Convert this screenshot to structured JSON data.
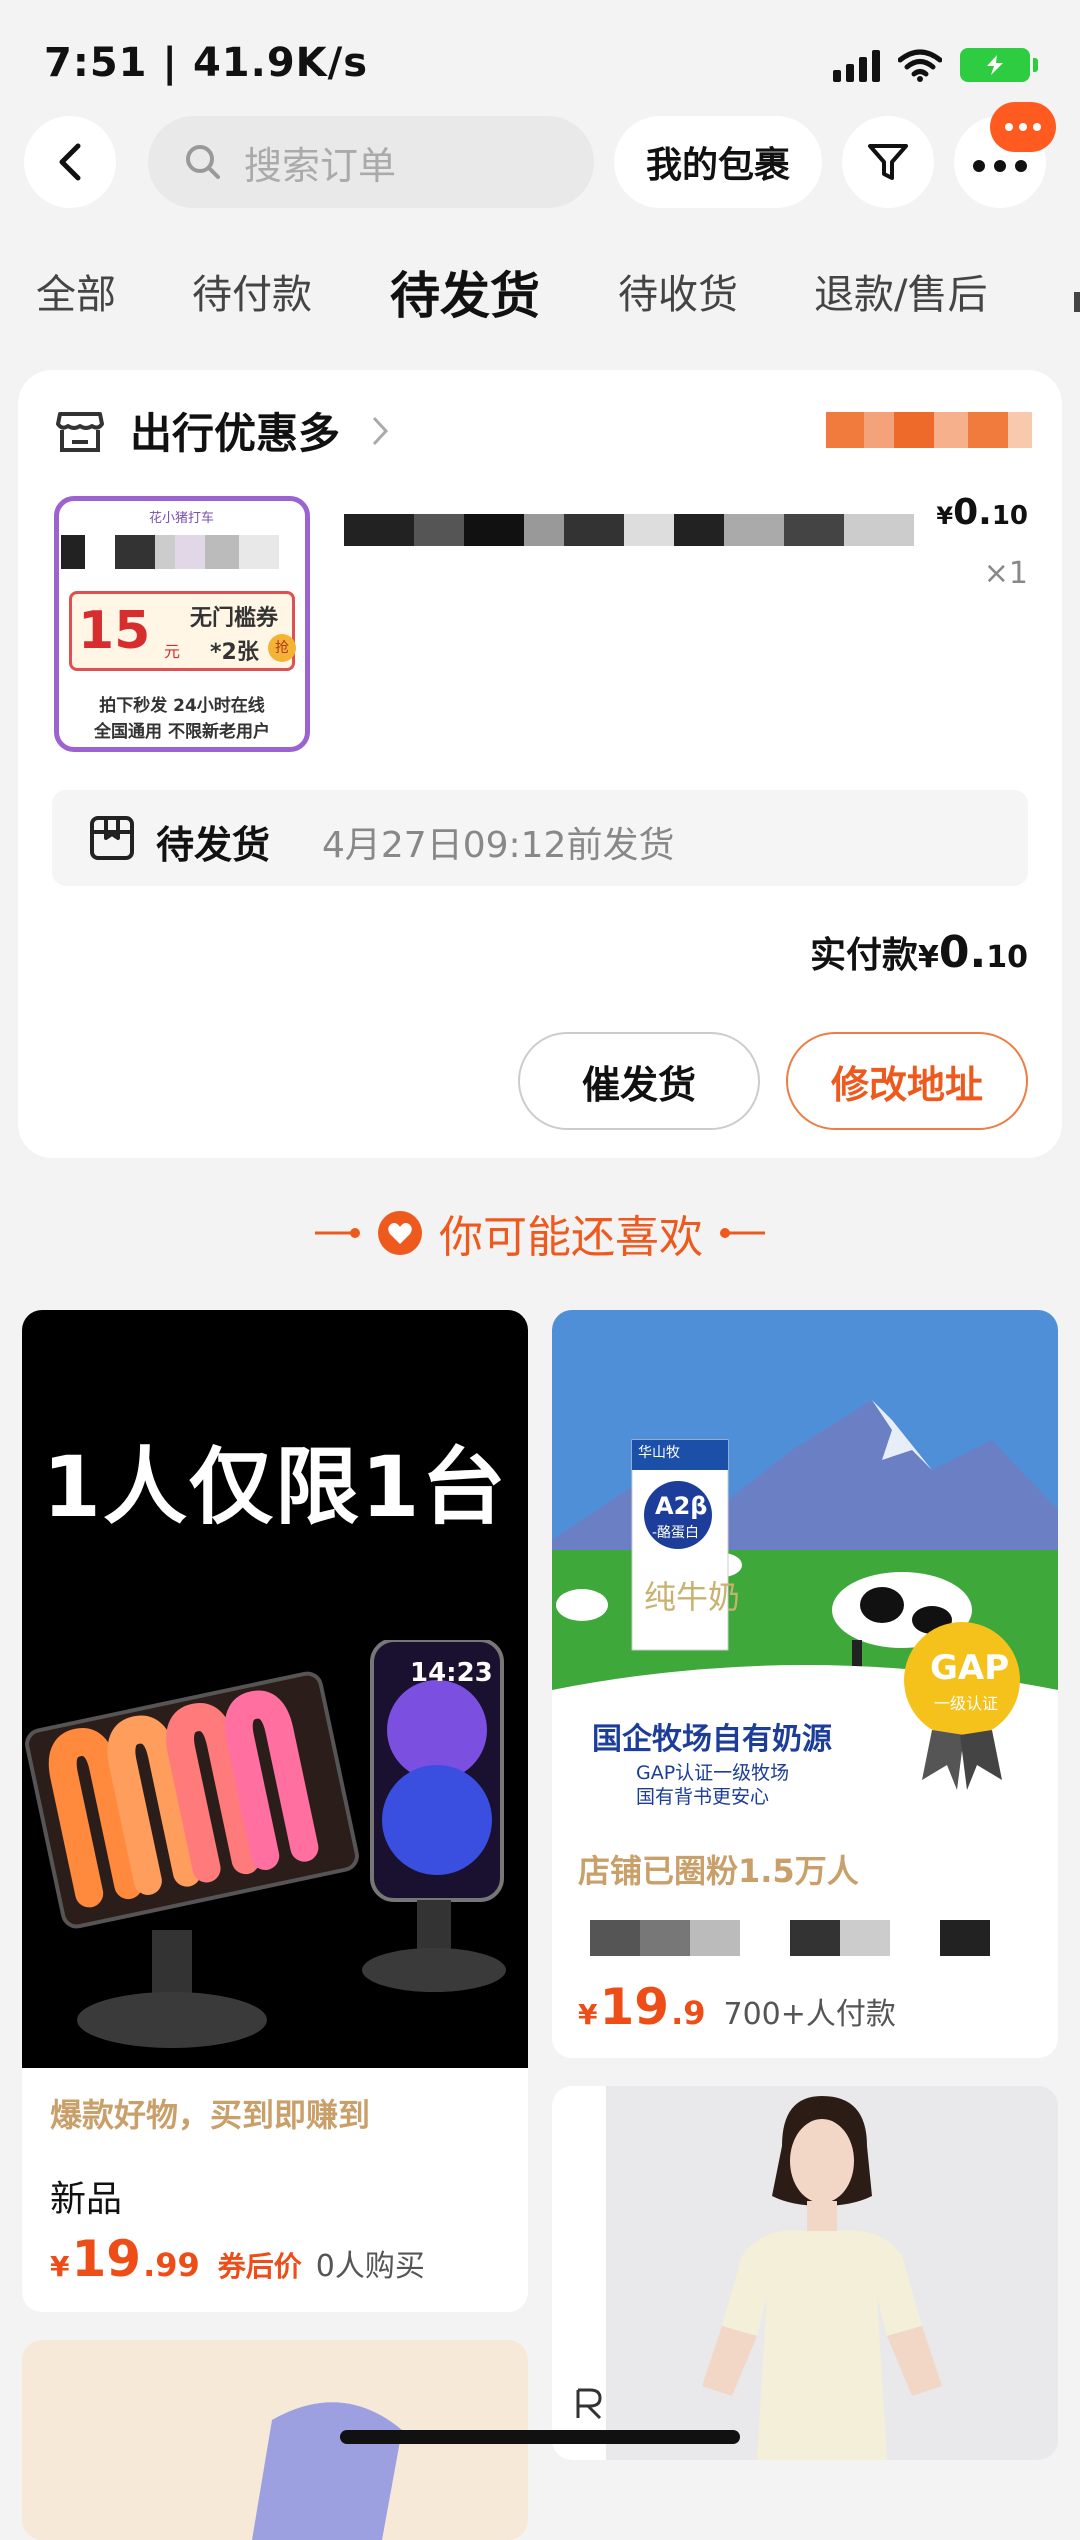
{
  "status_bar": {
    "time": "7:51 | 41.9K/s",
    "battery_icon": "battery-icon"
  },
  "header": {
    "search_placeholder": "搜索订单",
    "package_button": "我的包裹",
    "back_icon": "back-arrow-icon",
    "filter_icon": "filter-icon",
    "more_icon": "more-icon"
  },
  "tabs": [
    {
      "label": "全部",
      "active": false
    },
    {
      "label": "待付款",
      "active": false
    },
    {
      "label": "待发货",
      "active": true
    },
    {
      "label": "待收货",
      "active": false
    },
    {
      "label": "退款/售后",
      "active": false
    }
  ],
  "order": {
    "shop_name": "出行优惠多",
    "item_price_symbol": "¥",
    "item_price_int": "0.",
    "item_price_dec": "10",
    "quantity": "×1",
    "thumb": {
      "brand": "花小猪打车",
      "coupon_value": "15",
      "coupon_unit": "元",
      "coupon_text_1": "无门槛券",
      "coupon_text_2": "*2张",
      "grab": "抢",
      "line1": "拍下秒发 24小时在线",
      "line2": "全国通用 不限新老用户"
    },
    "status_label": "待发货",
    "status_detail": "4月27日09:12前发货",
    "paid_label": "实付款",
    "paid_symbol": "¥",
    "paid_int": "0.",
    "paid_dec": "10",
    "urge_button": "催发货",
    "edit_address_button": "修改地址"
  },
  "recommend": {
    "title": "你可能还喜欢",
    "items": [
      {
        "image_text": "1人仅限1台",
        "phone_time": "14:23",
        "tagline": "爆款好物，买到即赚到",
        "name": "新品",
        "price_symbol": "¥",
        "price_int": "19",
        "price_dec": ".99",
        "price_note": "券后价",
        "sales": "0人购买"
      },
      {
        "milk_brand": "华山牧",
        "milk_badge": "A2β",
        "milk_sub": "-酪蛋白",
        "milk_name": "纯牛奶",
        "banner": "国企牧场自有奶源",
        "banner_sub1": "GAP认证一级牧场",
        "banner_sub2": "国有背书更安心",
        "gap_badge": "GAP",
        "gap_sub": "一级认证",
        "shop_fans": "店铺已圈粉1.5万人",
        "price_symbol": "¥",
        "price_int": "19",
        "price_dec": ".9",
        "sales": "700+人付款"
      }
    ]
  },
  "colors": {
    "accent": "#ee5a1e",
    "price": "#ee4d18",
    "tan": "#c9a06a",
    "purple_border": "#9b62d0"
  }
}
